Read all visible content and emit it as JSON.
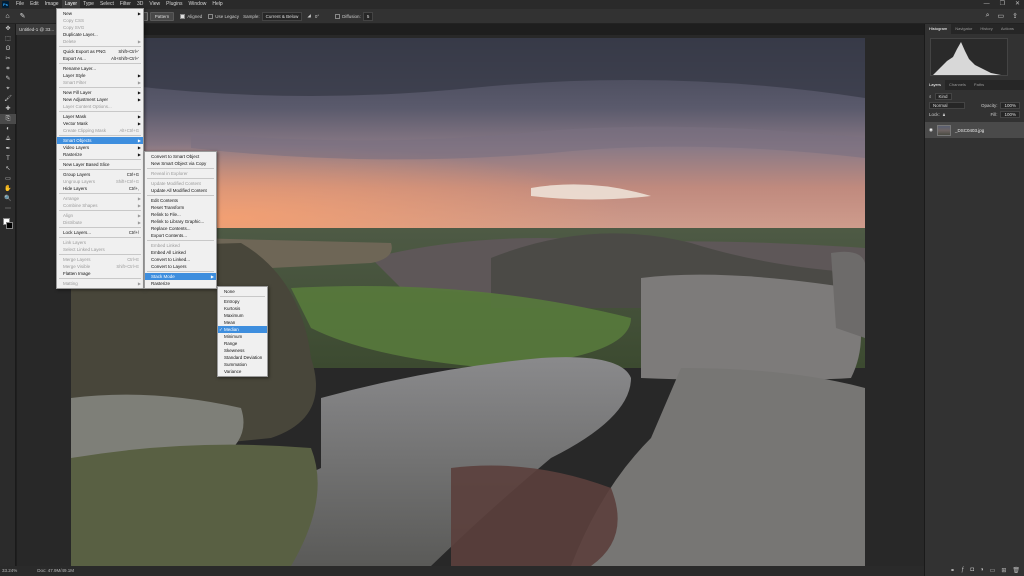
{
  "app_icon": "Ps",
  "menubar": [
    "File",
    "Edit",
    "Image",
    "Layer",
    "Type",
    "Select",
    "Filter",
    "3D",
    "View",
    "Plugins",
    "Window",
    "Help"
  ],
  "window_controls": [
    "—",
    "❐",
    "✕"
  ],
  "options": {
    "source_buttons": [
      "Sampled",
      "Pattern"
    ],
    "aligned": "Aligned",
    "use_legacy": "Use Legacy",
    "sample_label": "Sample:",
    "sample_value": "Current & Below",
    "angle": "0°",
    "diffusion_label": "Diffusion:",
    "diffusion_value": "5"
  },
  "doc_tab": "Untitled-1 @ 33...",
  "status": {
    "zoom": "33.24%",
    "doc_size": "Doc: 47.9M/49.1M"
  },
  "right_panel": {
    "top_tabs": [
      "Histogram",
      "Navigator",
      "History",
      "Actions"
    ],
    "layer_tabs": [
      "Layers",
      "Channels",
      "Paths"
    ],
    "kind": "Kind",
    "blend_mode": "Normal",
    "opacity_label": "Opacity:",
    "opacity_value": "100%",
    "lock_label": "Lock:",
    "fill_label": "Fill:",
    "fill_value": "100%",
    "layer_name": "_DSC0403.jpg"
  },
  "layer_menu": [
    {
      "label": "New",
      "arrow": true
    },
    {
      "label": "Copy CSS",
      "disabled": true
    },
    {
      "label": "Copy SVG",
      "disabled": true
    },
    {
      "label": "Duplicate Layer..."
    },
    {
      "label": "Delete",
      "arrow": true,
      "disabled": true
    },
    {
      "sep": true
    },
    {
      "label": "Quick Export as PNG",
      "shortcut": "Shift+Ctrl+'"
    },
    {
      "label": "Export As...",
      "shortcut": "Alt+Shift+Ctrl+'"
    },
    {
      "sep": true
    },
    {
      "label": "Rename Layer..."
    },
    {
      "label": "Layer Style",
      "arrow": true
    },
    {
      "label": "Smart Filter",
      "arrow": true,
      "disabled": true
    },
    {
      "sep": true
    },
    {
      "label": "New Fill Layer",
      "arrow": true
    },
    {
      "label": "New Adjustment Layer",
      "arrow": true
    },
    {
      "label": "Layer Content Options...",
      "disabled": true
    },
    {
      "sep": true
    },
    {
      "label": "Layer Mask",
      "arrow": true
    },
    {
      "label": "Vector Mask",
      "arrow": true
    },
    {
      "label": "Create Clipping Mask",
      "shortcut": "Alt+Ctrl+G",
      "disabled": true
    },
    {
      "sep": true
    },
    {
      "label": "Smart Objects",
      "arrow": true,
      "highlight": true
    },
    {
      "label": "Video Layers",
      "arrow": true
    },
    {
      "label": "Rasterize",
      "arrow": true
    },
    {
      "sep": true
    },
    {
      "label": "New Layer Based Slice"
    },
    {
      "sep": true
    },
    {
      "label": "Group Layers",
      "shortcut": "Ctrl+G"
    },
    {
      "label": "Ungroup Layers",
      "shortcut": "Shift+Ctrl+G",
      "disabled": true
    },
    {
      "label": "Hide Layers",
      "shortcut": "Ctrl+,"
    },
    {
      "sep": true
    },
    {
      "label": "Arrange",
      "arrow": true,
      "disabled": true
    },
    {
      "label": "Combine Shapes",
      "arrow": true,
      "disabled": true
    },
    {
      "sep": true
    },
    {
      "label": "Align",
      "arrow": true,
      "disabled": true
    },
    {
      "label": "Distribute",
      "arrow": true,
      "disabled": true
    },
    {
      "sep": true
    },
    {
      "label": "Lock Layers...",
      "shortcut": "Ctrl+/"
    },
    {
      "sep": true
    },
    {
      "label": "Link Layers",
      "disabled": true
    },
    {
      "label": "Select Linked Layers",
      "disabled": true
    },
    {
      "sep": true
    },
    {
      "label": "Merge Layers",
      "shortcut": "Ctrl+E",
      "disabled": true
    },
    {
      "label": "Merge Visible",
      "shortcut": "Shift+Ctrl+E",
      "disabled": true
    },
    {
      "label": "Flatten Image"
    },
    {
      "sep": true
    },
    {
      "label": "Matting",
      "arrow": true,
      "disabled": true
    }
  ],
  "smart_objects_menu": [
    {
      "label": "Convert to Smart Object"
    },
    {
      "label": "New Smart Object via Copy"
    },
    {
      "sep": true
    },
    {
      "label": "Reveal in Explorer",
      "disabled": true
    },
    {
      "sep": true
    },
    {
      "label": "Update Modified Content",
      "disabled": true
    },
    {
      "label": "Update All Modified Content"
    },
    {
      "sep": true
    },
    {
      "label": "Edit Contents"
    },
    {
      "label": "Reset Transform"
    },
    {
      "label": "Relink to File..."
    },
    {
      "label": "Relink to Library Graphic..."
    },
    {
      "label": "Replace Contents..."
    },
    {
      "label": "Export Contents..."
    },
    {
      "sep": true
    },
    {
      "label": "Embed Linked",
      "disabled": true
    },
    {
      "label": "Embed All Linked"
    },
    {
      "label": "Convert to Linked..."
    },
    {
      "label": "Convert to Layers"
    },
    {
      "sep": true
    },
    {
      "label": "Stack Mode",
      "arrow": true,
      "highlight": true
    },
    {
      "label": "Rasterize"
    }
  ],
  "stack_mode_menu": [
    {
      "label": "None"
    },
    {
      "sep": true
    },
    {
      "label": "Entropy"
    },
    {
      "label": "Kurtosis"
    },
    {
      "label": "Maximum"
    },
    {
      "label": "Mean"
    },
    {
      "label": "Median",
      "checked": true,
      "highlight": true
    },
    {
      "label": "Minimum"
    },
    {
      "label": "Range"
    },
    {
      "label": "Skewness"
    },
    {
      "label": "Standard Deviation"
    },
    {
      "label": "Summation"
    },
    {
      "label": "Variance"
    }
  ],
  "tools": [
    "✥",
    "⬚",
    "ʘ",
    "✂",
    "⌗",
    "✎",
    "⌖",
    "🖌",
    "✚",
    "⎘",
    "◐",
    "⟁",
    "✒",
    "T",
    "↖",
    "▭",
    "✋",
    "🔍",
    "⋯"
  ]
}
